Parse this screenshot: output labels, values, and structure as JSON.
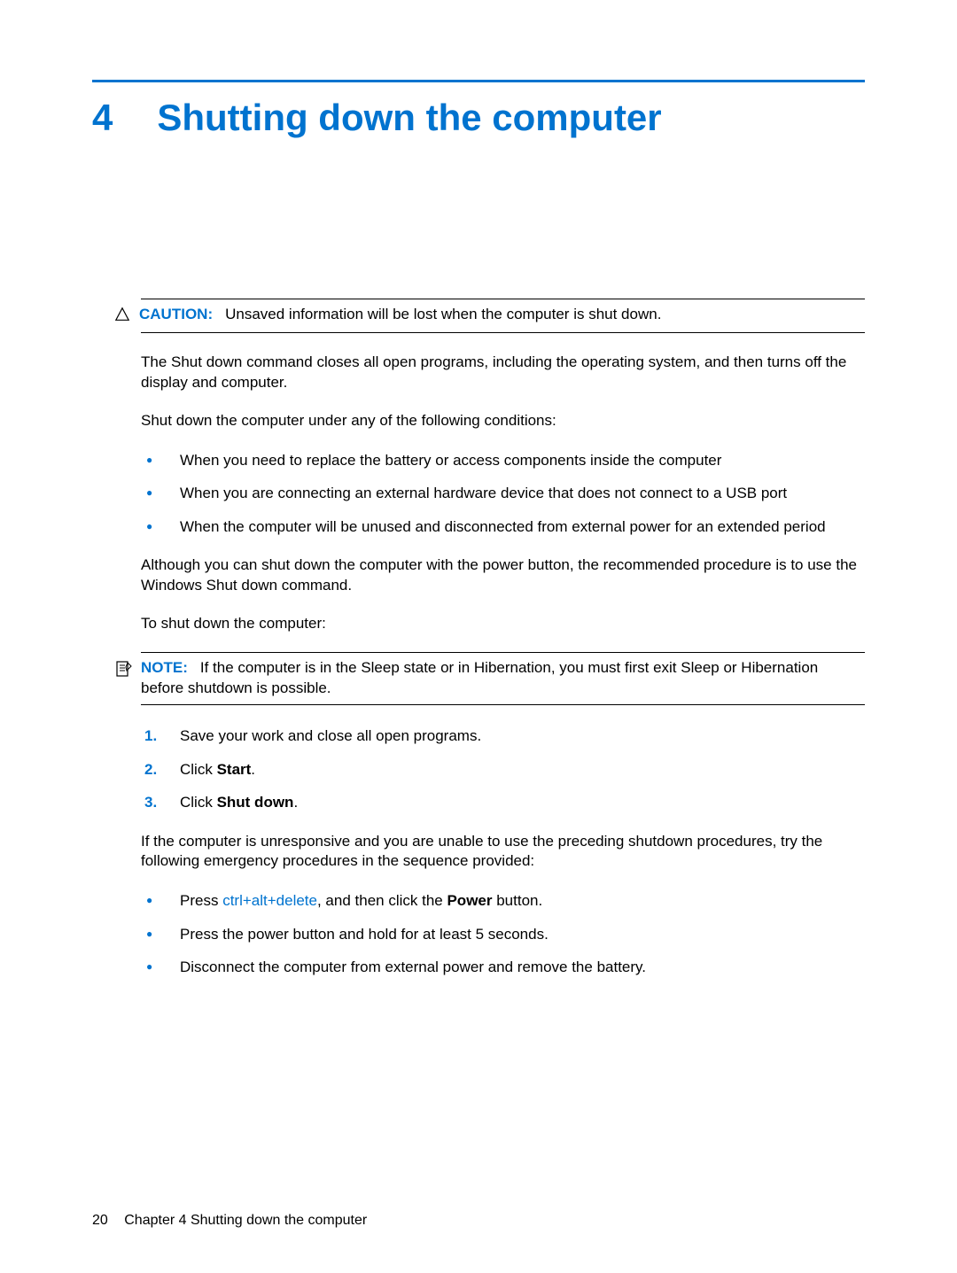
{
  "chapter": {
    "number": "4",
    "title": "Shutting down the computer"
  },
  "caution": {
    "label": "CAUTION:",
    "text": "Unsaved information will be lost when the computer is shut down."
  },
  "paragraphs": {
    "intro1": "The Shut down command closes all open programs, including the operating system, and then turns off the display and computer.",
    "intro2": "Shut down the computer under any of the following conditions:",
    "recommend": "Although you can shut down the computer with the power button, the recommended procedure is to use the Windows Shut down command.",
    "lead": "To shut down the computer:",
    "unresponsive": "If the computer is unresponsive and you are unable to use the preceding shutdown procedures, try the following emergency procedures in the sequence provided:"
  },
  "conditions": [
    "When you need to replace the battery or access components inside the computer",
    "When you are connecting an external hardware device that does not connect to a USB port",
    "When the computer will be unused and disconnected from external power for an extended period"
  ],
  "note": {
    "label": "NOTE:",
    "text": "If the computer is in the Sleep state or in Hibernation, you must first exit Sleep or Hibernation before shutdown is possible."
  },
  "steps": {
    "s1": "Save your work and close all open programs.",
    "s2_prefix": "Click ",
    "s2_bold": "Start",
    "s2_suffix": ".",
    "s3_prefix": "Click ",
    "s3_bold": "Shut down",
    "s3_suffix": "."
  },
  "emergency": {
    "e1_prefix": "Press ",
    "e1_key": "ctrl+alt+delete",
    "e1_mid": ", and then click the ",
    "e1_bold": "Power",
    "e1_suffix": " button.",
    "e2": "Press the power button and hold for at least 5 seconds.",
    "e3": "Disconnect the computer from external power and remove the battery."
  },
  "footer": {
    "page": "20",
    "chapter_label": "Chapter 4   Shutting down the computer"
  }
}
